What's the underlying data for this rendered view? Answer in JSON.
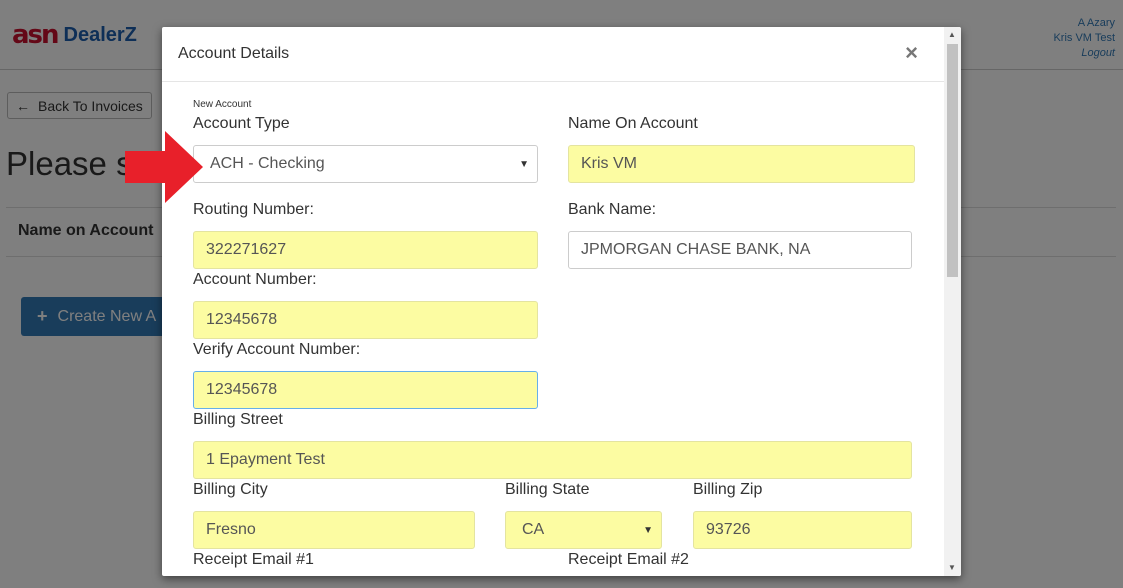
{
  "background": {
    "logo_mark": "asn",
    "logo_text": "DealerZ",
    "user": {
      "name": "A Azary",
      "account": "Kris VM Test",
      "logout": "Logout"
    },
    "back_button": "Back To Invoices",
    "heading": "Please s",
    "table_header": "Name on Account",
    "create_button": "Create New A"
  },
  "modal": {
    "title": "Account Details",
    "close": "×",
    "new_account_note": "New Account",
    "account_type": {
      "label": "Account Type",
      "value": "ACH - Checking"
    },
    "name_on_account": {
      "label": "Name On Account",
      "value": "Kris VM"
    },
    "routing_number": {
      "label": "Routing Number:",
      "value": "322271627"
    },
    "bank_name": {
      "label": "Bank Name:",
      "value": "JPMORGAN CHASE BANK, NA"
    },
    "account_number": {
      "label": "Account Number:",
      "value": "12345678"
    },
    "verify_account_number": {
      "label": "Verify Account Number:",
      "value": "12345678"
    },
    "billing_street": {
      "label": "Billing Street",
      "value": "1 Epayment Test"
    },
    "billing_city": {
      "label": "Billing City",
      "value": "Fresno"
    },
    "billing_state": {
      "label": "Billing State",
      "value": "CA"
    },
    "billing_zip": {
      "label": "Billing Zip",
      "value": "93726"
    },
    "receipt_email_1": {
      "label": "Receipt Email #1"
    },
    "receipt_email_2": {
      "label": "Receipt Email #2"
    }
  },
  "colors": {
    "autofill_yellow": "#fcfca2",
    "primary_blue": "#337ab7",
    "annotation_red": "#e8202a",
    "logo_red": "#c8102e",
    "logo_blue": "#1d5fae"
  }
}
